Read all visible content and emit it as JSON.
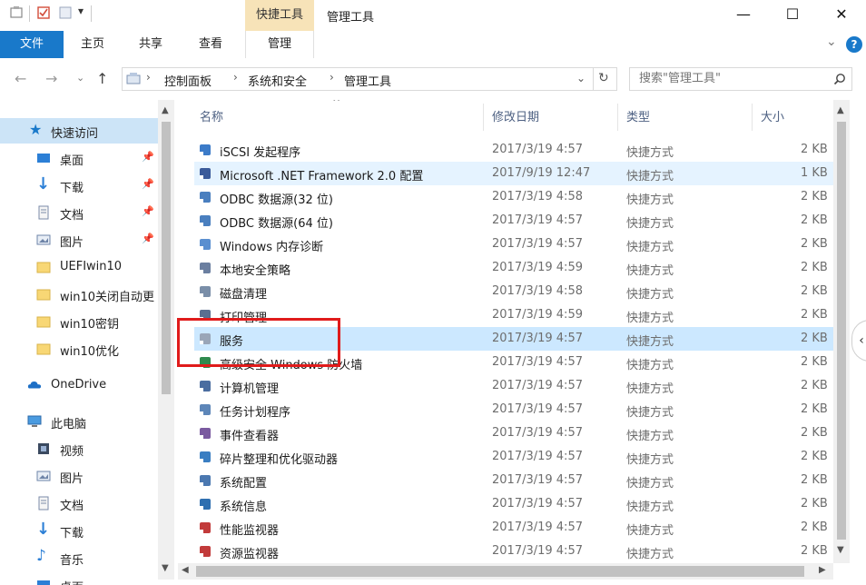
{
  "title_bar": {
    "context_tab_header": "快捷工具",
    "window_title": "管理工具",
    "minimize": "—",
    "maximize": "☐",
    "close": "✕"
  },
  "ribbon": {
    "tabs": [
      {
        "label": "文件"
      },
      {
        "label": "主页"
      },
      {
        "label": "共享"
      },
      {
        "label": "查看"
      },
      {
        "label": "管理"
      }
    ],
    "expand_glyph": "⌄",
    "help_glyph": "?"
  },
  "address": {
    "breadcrumbs": [
      "控制面板",
      "系统和安全",
      "管理工具"
    ],
    "search_placeholder": "搜索\"管理工具\""
  },
  "nav_pane": {
    "quick_access": "快速访问",
    "items": [
      {
        "label": "桌面",
        "pinned": true
      },
      {
        "label": "下载",
        "pinned": true
      },
      {
        "label": "文档",
        "pinned": true
      },
      {
        "label": "图片",
        "pinned": true
      },
      {
        "label": "UEFIwin10",
        "pinned": false
      },
      {
        "label": "win10关闭自动更",
        "pinned": false
      },
      {
        "label": "win10密钥",
        "pinned": false
      },
      {
        "label": "win10优化",
        "pinned": false
      }
    ],
    "onedrive": "OneDrive",
    "this_pc": "此电脑",
    "pc_items": [
      {
        "label": "视频"
      },
      {
        "label": "图片"
      },
      {
        "label": "文档"
      },
      {
        "label": "下载"
      },
      {
        "label": "音乐"
      },
      {
        "label": "桌面"
      }
    ]
  },
  "columns": {
    "name": "名称",
    "date": "修改日期",
    "type": "类型",
    "size": "大小"
  },
  "files": [
    {
      "name": "iSCSI 发起程序",
      "date": "2017/3/19 4:57",
      "type": "快捷方式",
      "size": "2 KB"
    },
    {
      "name": "Microsoft .NET Framework 2.0 配置",
      "date": "2017/9/19 12:47",
      "type": "快捷方式",
      "size": "1 KB"
    },
    {
      "name": "ODBC 数据源(32 位)",
      "date": "2017/3/19 4:58",
      "type": "快捷方式",
      "size": "2 KB"
    },
    {
      "name": "ODBC 数据源(64 位)",
      "date": "2017/3/19 4:57",
      "type": "快捷方式",
      "size": "2 KB"
    },
    {
      "name": "Windows 内存诊断",
      "date": "2017/3/19 4:57",
      "type": "快捷方式",
      "size": "2 KB"
    },
    {
      "name": "本地安全策略",
      "date": "2017/3/19 4:59",
      "type": "快捷方式",
      "size": "2 KB"
    },
    {
      "name": "磁盘清理",
      "date": "2017/3/19 4:58",
      "type": "快捷方式",
      "size": "2 KB"
    },
    {
      "name": "打印管理",
      "date": "2017/3/19 4:59",
      "type": "快捷方式",
      "size": "2 KB"
    },
    {
      "name": "服务",
      "date": "2017/3/19 4:57",
      "type": "快捷方式",
      "size": "2 KB"
    },
    {
      "name": "高级安全 Windows 防火墙",
      "date": "2017/3/19 4:57",
      "type": "快捷方式",
      "size": "2 KB"
    },
    {
      "name": "计算机管理",
      "date": "2017/3/19 4:57",
      "type": "快捷方式",
      "size": "2 KB"
    },
    {
      "name": "任务计划程序",
      "date": "2017/3/19 4:57",
      "type": "快捷方式",
      "size": "2 KB"
    },
    {
      "name": "事件查看器",
      "date": "2017/3/19 4:57",
      "type": "快捷方式",
      "size": "2 KB"
    },
    {
      "name": "碎片整理和优化驱动器",
      "date": "2017/3/19 4:57",
      "type": "快捷方式",
      "size": "2 KB"
    },
    {
      "name": "系统配置",
      "date": "2017/3/19 4:57",
      "type": "快捷方式",
      "size": "2 KB"
    },
    {
      "name": "系统信息",
      "date": "2017/3/19 4:57",
      "type": "快捷方式",
      "size": "2 KB"
    },
    {
      "name": "性能监视器",
      "date": "2017/3/19 4:57",
      "type": "快捷方式",
      "size": "2 KB"
    },
    {
      "name": "资源监视器",
      "date": "2017/3/19 4:57",
      "type": "快捷方式",
      "size": "2 KB"
    }
  ],
  "colors": {
    "accent": "#1979ca",
    "selection": "#cce8ff",
    "context_tab": "#f7e3b8",
    "highlight_box": "#e01b1b"
  }
}
